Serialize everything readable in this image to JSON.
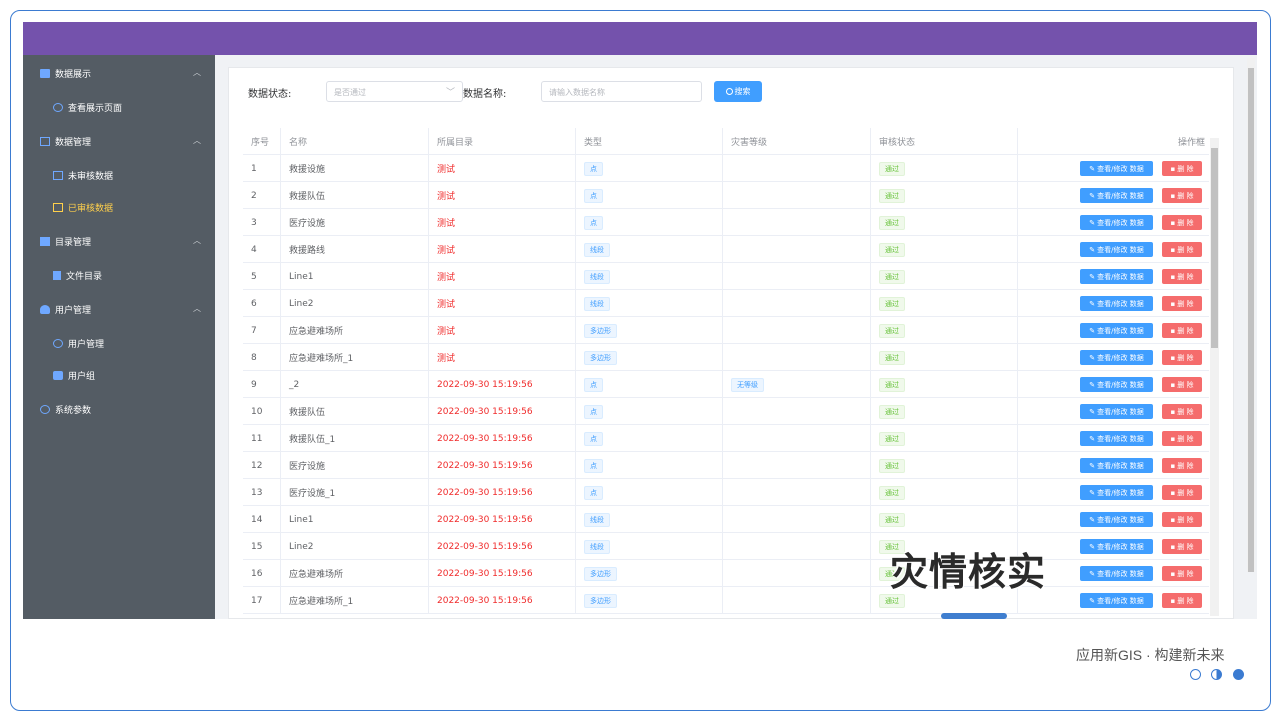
{
  "sidebar": {
    "groups": [
      {
        "label": "数据展示",
        "icon": "dashboard-icon",
        "items": [
          {
            "label": "查看展示页面",
            "icon": "view-icon"
          }
        ]
      },
      {
        "label": "数据管理",
        "icon": "data-manage-icon",
        "items": [
          {
            "label": "未审核数据",
            "icon": "pending-icon"
          },
          {
            "label": "已审核数据",
            "icon": "approved-icon"
          }
        ]
      },
      {
        "label": "目录管理",
        "icon": "folder-icon",
        "items": [
          {
            "label": "文件目录",
            "icon": "file-icon"
          }
        ]
      },
      {
        "label": "用户管理",
        "icon": "user-icon",
        "items": [
          {
            "label": "用户管理",
            "icon": "users-icon"
          },
          {
            "label": "用户组",
            "icon": "group-icon"
          }
        ]
      },
      {
        "label": "系统参数",
        "icon": "gear-icon",
        "items": []
      }
    ],
    "active": "已审核数据"
  },
  "filters": {
    "status_label": "数据状态:",
    "status_placeholder": "是否通过",
    "name_label": "数据名称:",
    "name_placeholder": "请输入数据名称",
    "search_button": "搜索"
  },
  "table": {
    "headers": [
      "序号",
      "名称",
      "所属目录",
      "类型",
      "灾害等级",
      "审核状态",
      "操作框"
    ],
    "rows": [
      {
        "no": "1",
        "name": "救援设施",
        "dir": "测试",
        "type": "点",
        "level": "",
        "status": "通过"
      },
      {
        "no": "2",
        "name": "救援队伍",
        "dir": "测试",
        "type": "点",
        "level": "",
        "status": "通过"
      },
      {
        "no": "3",
        "name": "医疗设施",
        "dir": "测试",
        "type": "点",
        "level": "",
        "status": "通过"
      },
      {
        "no": "4",
        "name": "救援路线",
        "dir": "测试",
        "type": "线段",
        "level": "",
        "status": "通过"
      },
      {
        "no": "5",
        "name": "Line1",
        "dir": "测试",
        "type": "线段",
        "level": "",
        "status": "通过"
      },
      {
        "no": "6",
        "name": "Line2",
        "dir": "测试",
        "type": "线段",
        "level": "",
        "status": "通过"
      },
      {
        "no": "7",
        "name": "应急避难场所",
        "dir": "测试",
        "type": "多边形",
        "level": "",
        "status": "通过"
      },
      {
        "no": "8",
        "name": "应急避难场所_1",
        "dir": "测试",
        "type": "多边形",
        "level": "",
        "status": "通过"
      },
      {
        "no": "9",
        "name": "_2",
        "dir": "2022-09-30 15:19:56",
        "type": "点",
        "level": "无等级",
        "status": "通过"
      },
      {
        "no": "10",
        "name": "救援队伍",
        "dir": "2022-09-30 15:19:56",
        "type": "点",
        "level": "",
        "status": "通过"
      },
      {
        "no": "11",
        "name": "救援队伍_1",
        "dir": "2022-09-30 15:19:56",
        "type": "点",
        "level": "",
        "status": "通过"
      },
      {
        "no": "12",
        "name": "医疗设施",
        "dir": "2022-09-30 15:19:56",
        "type": "点",
        "level": "",
        "status": "通过"
      },
      {
        "no": "13",
        "name": "医疗设施_1",
        "dir": "2022-09-30 15:19:56",
        "type": "点",
        "level": "",
        "status": "通过"
      },
      {
        "no": "14",
        "name": "Line1",
        "dir": "2022-09-30 15:19:56",
        "type": "线段",
        "level": "",
        "status": "通过"
      },
      {
        "no": "15",
        "name": "Line2",
        "dir": "2022-09-30 15:19:56",
        "type": "线段",
        "level": "",
        "status": "通过"
      },
      {
        "no": "16",
        "name": "应急避难场所",
        "dir": "2022-09-30 15:19:56",
        "type": "多边形",
        "level": "",
        "status": "通过"
      },
      {
        "no": "17",
        "name": "应急避难场所_1",
        "dir": "2022-09-30 15:19:56",
        "type": "多边形",
        "level": "",
        "status": "通过"
      }
    ],
    "edit_label": "查看/修改 数据",
    "delete_label": "删 除"
  },
  "overlay_title": "灾情核实",
  "slogan": "应用新GIS · 构建新未来",
  "colors": {
    "topbar": "#7452ac",
    "sidebar": "#545c64",
    "active_menu": "#ffd04b",
    "primary": "#409eff",
    "danger": "#f56c6c",
    "dir_text": "#f02b2b"
  }
}
